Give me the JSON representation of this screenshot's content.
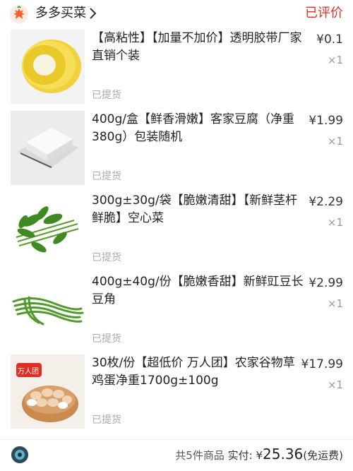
{
  "header": {
    "store_name": "多多买菜",
    "order_status": "已评价"
  },
  "items": [
    {
      "title": "【高粘性】【加量不加价】透明胶带厂家直销个装",
      "price": "¥0.1",
      "qty": "×1",
      "status": "已提货",
      "icon": "tape-image"
    },
    {
      "title": "400g/盒【鲜香滑嫩】客家豆腐（净重380g）包装随机",
      "price": "¥1.99",
      "qty": "×1",
      "status": "已提货",
      "icon": "tofu-image"
    },
    {
      "title": "300g±30g/袋【脆嫩清甜】【新鲜茎杆鲜脆】空心菜",
      "price": "¥2.29",
      "qty": "×1",
      "status": "已提货",
      "icon": "water-spinach-image"
    },
    {
      "title": "400g±40g/份【脆嫩香甜】新鲜豇豆长豆角",
      "price": "¥2.99",
      "qty": "×1",
      "status": "已提货",
      "icon": "long-bean-image"
    },
    {
      "title": "30枚/份【超低价 万人团】农家谷物草鸡蛋净重1700g±100g",
      "price": "¥17.99",
      "qty": "×1",
      "status": "已提货",
      "icon": "eggs-image",
      "badge": "万人团"
    }
  ],
  "footer": {
    "count_text": "共5件商品",
    "paid_label": "实付:",
    "currency": "¥",
    "total": "25.36",
    "shipping_note": "(免运费)"
  },
  "colors": {
    "accent": "#e02e24",
    "muted": "#aaaaaa"
  }
}
